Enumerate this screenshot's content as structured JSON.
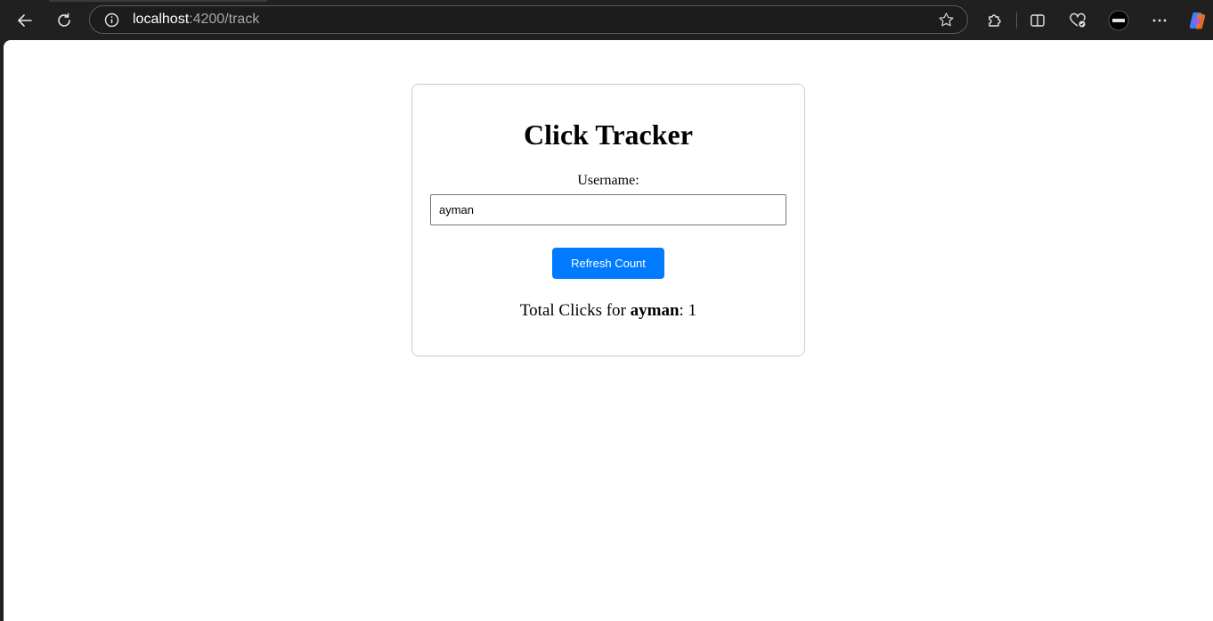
{
  "browser": {
    "url_host": "localhost",
    "url_path": ":4200/track",
    "icons": [
      "back-arrow-icon",
      "reload-icon",
      "info-icon",
      "star-icon",
      "extensions-icon",
      "split-screen-icon",
      "health-icon",
      "profile-icon",
      "more-icon",
      "copilot-icon"
    ]
  },
  "page": {
    "title": "Click Tracker",
    "username_label": "Username:",
    "username_value": "ayman",
    "refresh_button_label": "Refresh Count",
    "result_prefix": "Total Clicks for ",
    "result_username": "ayman",
    "result_separator": ": ",
    "result_count": "1"
  },
  "colors": {
    "button_bg": "#007bff",
    "chrome_bg": "#202020"
  }
}
